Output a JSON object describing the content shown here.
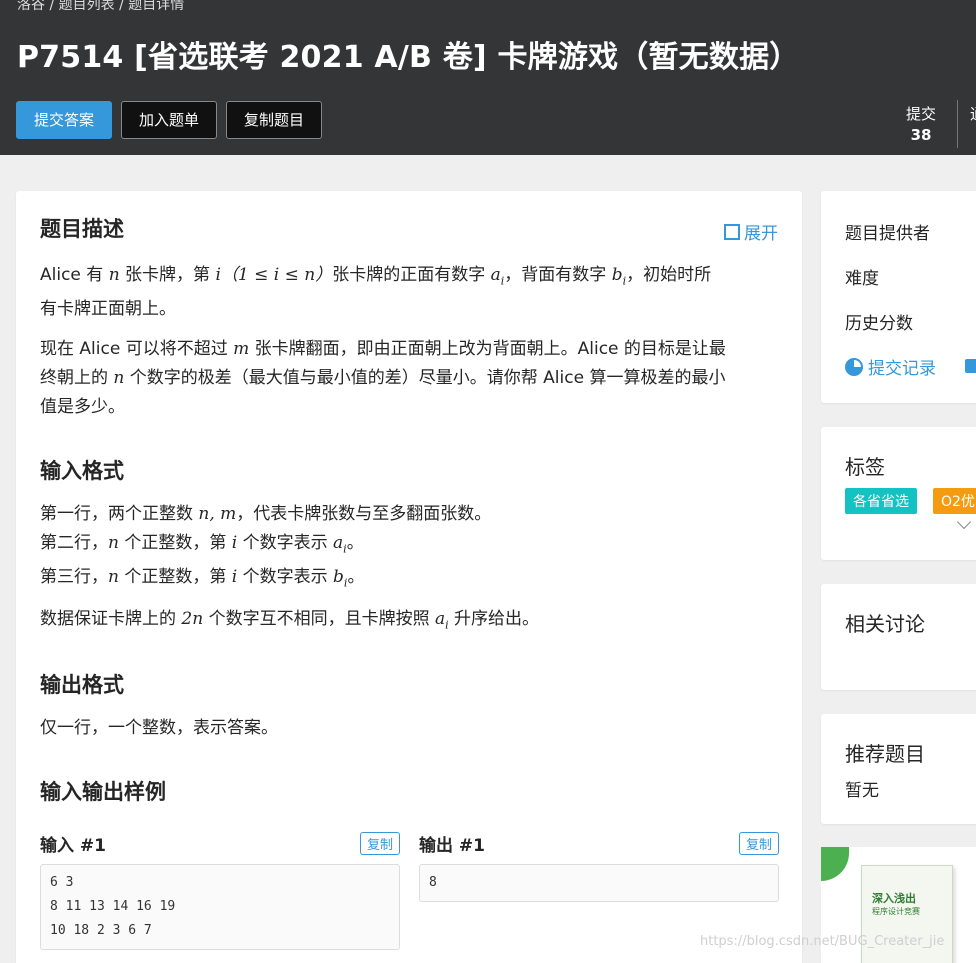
{
  "breadcrumb": [
    "洛谷",
    "题目列表",
    "题目详情"
  ],
  "breadcrumb_sep": " / ",
  "title": "P7514 [省选联考 2021 A/B 卷] 卡牌游戏（暂无数据）",
  "buttons": {
    "submit": "提交答案",
    "add_list": "加入题单",
    "copy_problem": "复制题目"
  },
  "stats": {
    "submit_label": "提交",
    "submit_count": "38",
    "cut_label": "通"
  },
  "expand_label": "展开",
  "sections": {
    "desc_title": "题目描述",
    "input_title": "输入格式",
    "output_title": "输出格式",
    "samples_title": "输入输出样例"
  },
  "desc": {
    "p1_a": "Alice 有 ",
    "p1_n": "n",
    "p1_b": " 张卡牌，第 ",
    "p1_math": "i（1 ≤ i ≤ n）",
    "p1_c": "张卡牌的正面有数字 ",
    "p1_ai": "a",
    "p1_d": "，背面有数字 ",
    "p1_bi": "b",
    "p1_e": "，初始时所",
    "p1_line2": "有卡牌正面朝上。",
    "p2_a": "现在 Alice 可以将不超过 ",
    "p2_m": "m",
    "p2_b": " 张卡牌翻面，即由正面朝上改为背面朝上。Alice 的目标是让最",
    "p2_line2_a": "终朝上的 ",
    "p2_n": "n",
    "p2_line2_b": " 个数字的极差（最大值与最小值的差）尽量小。请你帮 Alice 算一算极差的最小",
    "p2_line3": "值是多少。"
  },
  "input": {
    "l1_a": "第一行，两个正整数 ",
    "l1_math": "n, m",
    "l1_b": "，代表卡牌张数与至多翻面张数。",
    "l2_a": "第二行，",
    "l2_n": "n",
    "l2_b": " 个正整数，第 ",
    "l2_i": "i",
    "l2_c": " 个数字表示 ",
    "l2_var": "a",
    "l2_d": "。",
    "l3_a": "第三行，",
    "l3_n": "n",
    "l3_b": " 个正整数，第 ",
    "l3_i": "i",
    "l3_c": " 个数字表示 ",
    "l3_var": "b",
    "l3_d": "。",
    "note_a": "数据保证卡牌上的 ",
    "note_math": "2n",
    "note_b": " 个数字互不相同，且卡牌按照 ",
    "note_var": "a",
    "note_c": " 升序给出。",
    "sub_i": "i"
  },
  "output": {
    "text": "仅一行，一个整数，表示答案。"
  },
  "samples": {
    "in_label": "输入 #1",
    "out_label": "输出 #1",
    "copy": "复制",
    "in_text": "6 3\n8 11 13 14 16 19\n10 18 2 3 6 7",
    "out_text": "8"
  },
  "sidebar": {
    "provider": "题目提供者",
    "difficulty": "难度",
    "history": "历史分数",
    "records": "提交记录",
    "tags_title": "标签",
    "tags": [
      "各省省选",
      "O2优"
    ],
    "tag_colors": [
      "#13c2c2",
      "#f39c11"
    ],
    "discuss_title": "相关讨论",
    "recommend_title": "推荐题目",
    "recommend_empty": "暂无"
  },
  "ad": {
    "title": "深入浅出",
    "subtitle": "程序设计竞赛"
  },
  "watermark": "https://blog.csdn.net/BUG_Creater_jie"
}
